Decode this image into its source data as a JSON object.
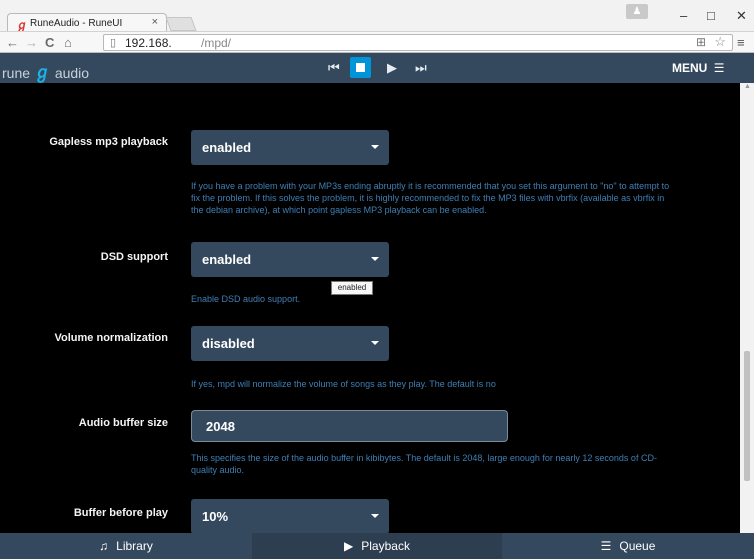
{
  "browser": {
    "tab_title": "RuneAudio - RuneUI",
    "tab_close": "×",
    "url_host": "192.168.",
    "url_path": "/mpd/",
    "window_minimize": "–",
    "window_maximize": "□",
    "window_close": "✕"
  },
  "app": {
    "logo_left": "rune",
    "logo_right": "audio",
    "menu_label": "MENU"
  },
  "settings": [
    {
      "label": "Gapless mp3 playback",
      "value": "enabled",
      "help": "If you have a problem with your MP3s ending abruptly it is recommended that you set this argument to \"no\" to attempt to fix the problem. If this solves the problem, it is highly recommended to fix the MP3 files with vbrfix (available as vbrfix in the debian archive), at which point gapless MP3 playback can be enabled."
    },
    {
      "label": "DSD support",
      "value": "enabled",
      "help": "Enable DSD audio support."
    },
    {
      "label": "Volume normalization",
      "value": "disabled",
      "help": "If yes, mpd will normalize the volume of songs as they play. The default is no"
    },
    {
      "label": "Audio buffer size",
      "value": "2048",
      "help": "This specifies the size of the audio buffer in kibibytes. The default is 2048, large enough for nearly 12 seconds of CD-quality audio."
    },
    {
      "label": "Buffer before play",
      "value": "10%"
    }
  ],
  "tooltip": "enabled",
  "bottom_nav": {
    "library": "Library",
    "playback": "Playback",
    "queue": "Queue"
  }
}
